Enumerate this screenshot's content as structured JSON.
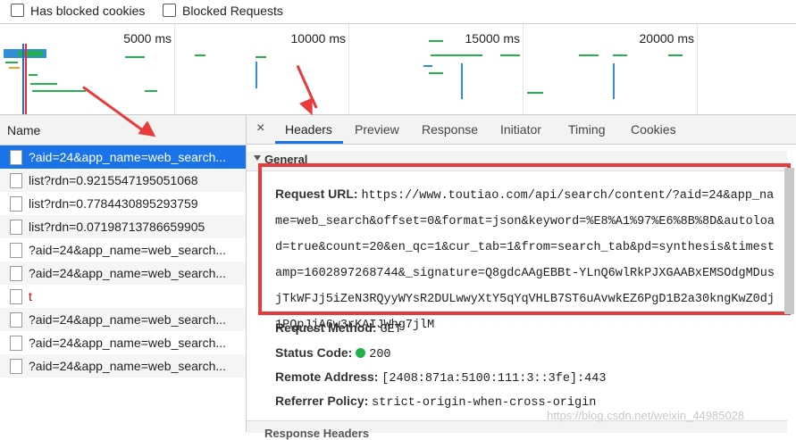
{
  "filters": [
    {
      "label": "Has blocked cookies",
      "checked": false
    },
    {
      "label": "Blocked Requests",
      "checked": false
    }
  ],
  "overview": {
    "ticks": [
      "5000 ms",
      "10000 ms",
      "15000 ms",
      "20000 ms"
    ]
  },
  "requests": {
    "header": "Name",
    "rows": [
      {
        "name": "?aid=24&app_name=web_search...",
        "selected": true,
        "error": false
      },
      {
        "name": "list?rdn=0.9215547195051068",
        "selected": false,
        "error": false
      },
      {
        "name": "list?rdn=0.7784430895293759",
        "selected": false,
        "error": false
      },
      {
        "name": "list?rdn=0.07198713786659905",
        "selected": false,
        "error": false
      },
      {
        "name": "?aid=24&app_name=web_search...",
        "selected": false,
        "error": false
      },
      {
        "name": "?aid=24&app_name=web_search...",
        "selected": false,
        "error": false
      },
      {
        "name": "t",
        "selected": false,
        "error": true
      },
      {
        "name": "?aid=24&app_name=web_search...",
        "selected": false,
        "error": false
      },
      {
        "name": "?aid=24&app_name=web_search...",
        "selected": false,
        "error": false
      },
      {
        "name": "?aid=24&app_name=web_search...",
        "selected": false,
        "error": false
      }
    ]
  },
  "detail": {
    "close_icon": "×",
    "tabs": [
      "Headers",
      "Preview",
      "Response",
      "Initiator",
      "Timing",
      "Cookies"
    ],
    "active_tab": "Headers",
    "section_title": "General",
    "request_url_label": "Request URL:",
    "request_url": "https://www.toutiao.com/api/search/content/?aid=24&app_name=web_search&offset=0&format=json&keyword=%E8%A1%97%E6%8B%8D&autoload=true&count=20&en_qc=1&cur_tab=1&from=search_tab&pd=synthesis&timestamp=1602897268744&_signature=Q8gdcAAgEBBt-YLnQ6wlRkPJXGAABxEMSOdgMDusjTkWFJj5iZeN3RQyyWYsR2DULwwyXtY5qYqVHLB7ST6uAvwkEZ6PgD1B2a30kngKwZ0dj1PQpJjA6w3rKAIJWhg7jlM",
    "request_method_label": "Request Method:",
    "request_method": "GET",
    "status_code_label": "Status Code:",
    "status_code": "200",
    "remote_address_label": "Remote Address:",
    "remote_address": "[2408:871a:5100:111:3::3fe]:443",
    "referrer_policy_label": "Referrer Policy:",
    "referrer_policy": "strict-origin-when-cross-origin",
    "next_section_title": "Response Headers"
  },
  "watermark": "https://blog.csdn.net/weixin_44985028",
  "colors": {
    "selected_row": "#1a73e8",
    "highlight_box": "#e83a3a",
    "status_ok": "#22b14c"
  }
}
